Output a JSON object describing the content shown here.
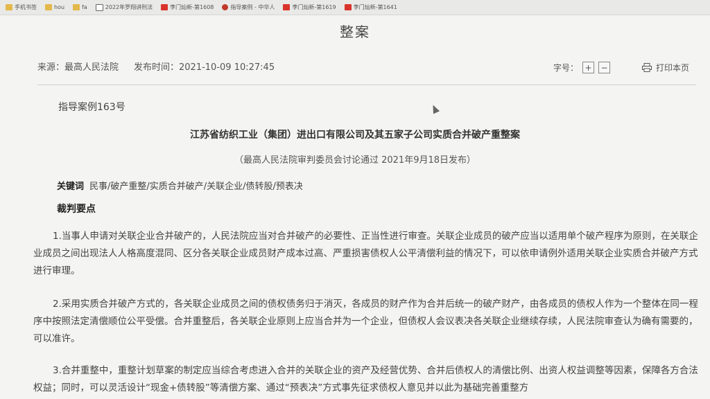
{
  "bookmarks": [
    {
      "label": "手机书签",
      "icon": "folder-icon"
    },
    {
      "label": "hou",
      "icon": "folder-icon"
    },
    {
      "label": "fa",
      "icon": "folder-icon"
    },
    {
      "label": "2022年罗翔讲刑法",
      "icon": "calendar-icon"
    },
    {
      "label": "李门灿新-第1608",
      "icon": "red-icon"
    },
    {
      "label": "指导案例 - 中华人",
      "icon": "circle-icon"
    },
    {
      "label": "李门灿新-第1619",
      "icon": "red-icon"
    },
    {
      "label": "李门灿新-第1641",
      "icon": "red-icon"
    }
  ],
  "page": {
    "title": "整案",
    "source": "来源：最高人民法院",
    "publish_time": "发布时间：2021-10-09 10:27:45",
    "font_size_label": "字号：",
    "increase": "+",
    "decrease": "−",
    "print_label": "打印本页"
  },
  "article": {
    "case_number": "指导案例163号",
    "title": "江苏省纺织工业（集团）进出口有限公司及其五家子公司实质合并破产重整案",
    "subtitle": "（最高人民法院审判委员会讨论通过 2021年9月18日发布）",
    "keywords_label": "关键词",
    "keywords": "民事/破产重整/实质合并破产/关联企业/债转股/预表决",
    "section_heading": "裁判要点",
    "paragraphs": [
      "1.当事人申请对关联企业合并破产的，人民法院应当对合并破产的必要性、正当性进行审查。关联企业成员的破产应当以适用单个破产程序为原则，在关联企业成员之间出现法人人格高度混同、区分各关联企业成员财产成本过高、严重损害债权人公平清偿利益的情况下，可以依申请例外适用关联企业实质合并破产方式进行审理。",
      "2.采用实质合并破产方式的，各关联企业成员之间的债权债务归于消灭，各成员的财产作为合并后统一的破产财产，由各成员的债权人作为一个整体在同一程序中按照法定清偿顺位公平受偿。合并重整后，各关联企业原则上应当合并为一个企业，但债权人会议表决各关联企业继续存续，人民法院审查认为确有需要的，可以准许。",
      "3.合并重整中，重整计划草案的制定应当综合考虑进入合并的关联企业的资产及经营优势、合并后债权人的清偿比例、出资人权益调整等因素，保障各方合法权益；同时，可以灵活设计“现金+债转股”等清偿方案、通过“预表决”方式事先征求债权人意见并以此为基础完善重整方"
    ]
  }
}
